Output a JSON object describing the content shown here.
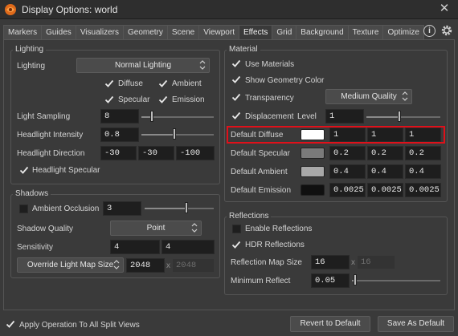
{
  "window": {
    "title": "Display Options:  world"
  },
  "tabs": [
    "Markers",
    "Guides",
    "Visualizers",
    "Geometry",
    "Scene",
    "Viewport",
    "Effects",
    "Grid",
    "Background",
    "Texture",
    "Optimize"
  ],
  "active_tab": "Effects",
  "help_label": "i",
  "lighting": {
    "group_title": "Lighting",
    "lighting_label": "Lighting",
    "lighting_value": "Normal Lighting",
    "diffuse_label": "Diffuse",
    "ambient_label": "Ambient",
    "specular_label": "Specular",
    "emission_label": "Emission",
    "light_sampling_label": "Light Sampling",
    "light_sampling_value": "8",
    "headlight_intensity_label": "Headlight Intensity",
    "headlight_intensity_value": "0.8",
    "headlight_direction_label": "Headlight Direction",
    "headlight_direction": [
      "-30",
      "-30",
      "-100"
    ],
    "headlight_specular_label": "Headlight Specular"
  },
  "shadows": {
    "group_title": "Shadows",
    "ambient_occlusion_label": "Ambient Occlusion",
    "ambient_occlusion_value": "3",
    "shadow_quality_label": "Shadow Quality",
    "shadow_quality_value": "Point",
    "sensitivity_label": "Sensitivity",
    "sensitivity_values": [
      "4",
      "4"
    ],
    "override_label": "Override Light Map Size",
    "map_size_values": [
      "2048",
      "2048"
    ],
    "x_sep": "x"
  },
  "material": {
    "group_title": "Material",
    "use_materials_label": "Use Materials",
    "show_geometry_color_label": "Show Geometry Color",
    "transparency_label": "Transparency",
    "transparency_value": "Medium Quality",
    "displacement_label": "Displacement",
    "level_label": "Level",
    "level_value": "1",
    "default_diffuse_label": "Default Diffuse",
    "default_diffuse": [
      "1",
      "1",
      "1"
    ],
    "default_specular_label": "Default Specular",
    "default_specular": [
      "0.2",
      "0.2",
      "0.2"
    ],
    "default_ambient_label": "Default Ambient",
    "default_ambient": [
      "0.4",
      "0.4",
      "0.4"
    ],
    "default_emission_label": "Default Emission",
    "default_emission": [
      "0.0025",
      "0.0025",
      "0.0025"
    ],
    "swatch_colors": {
      "diffuse": "#ffffff",
      "specular": "#7a7a7a",
      "ambient": "#a8a8a8",
      "emission": "#101010"
    }
  },
  "reflections": {
    "group_title": "Reflections",
    "enable_reflections_label": "Enable Reflections",
    "hdr_reflections_label": "HDR Reflections",
    "reflection_map_size_label": "Reflection Map Size",
    "reflection_map_size_values": [
      "16",
      "16"
    ],
    "minimum_reflect_label": "Minimum Reflect",
    "minimum_reflect_value": "0.05",
    "x_sep": "x"
  },
  "footer": {
    "apply_label": "Apply Operation To All Split Views",
    "revert_button": "Revert to Default",
    "save_button": "Save As Default"
  },
  "colors": {
    "highlight": "#e0101a"
  }
}
